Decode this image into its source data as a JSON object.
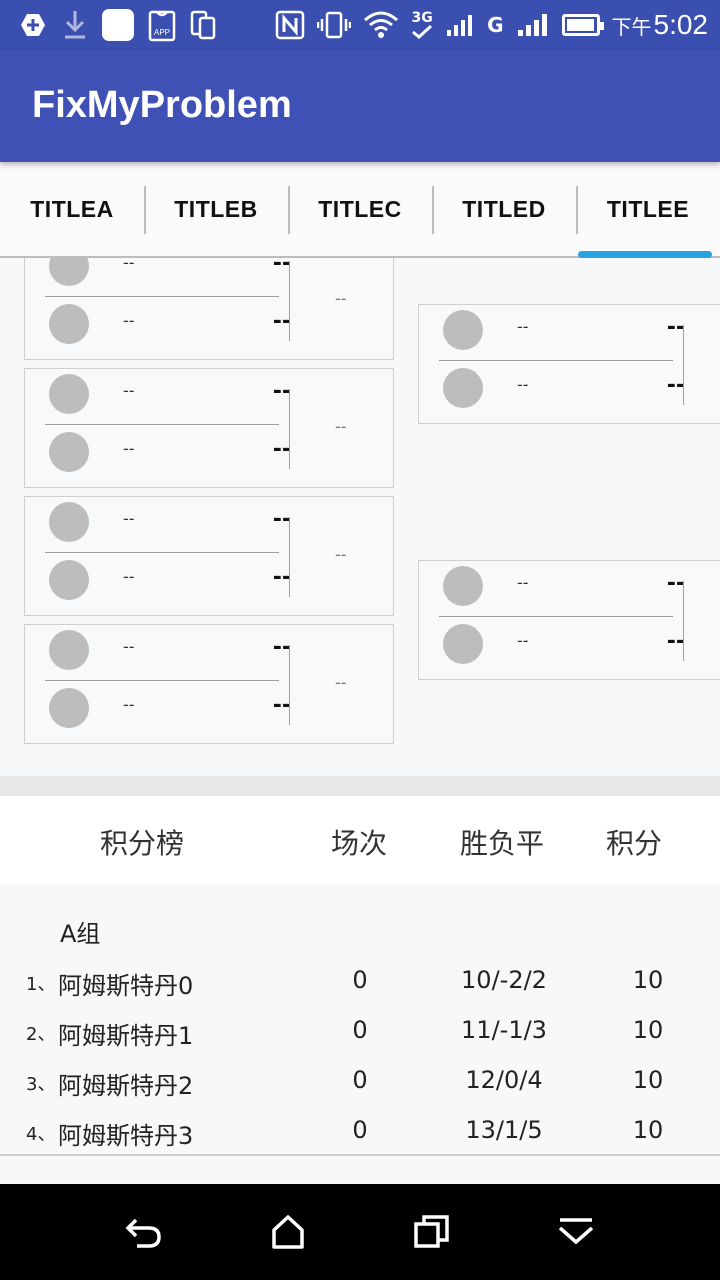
{
  "status_bar": {
    "time_prefix": "下午",
    "time": "5:02",
    "network_3g": "3G",
    "network_g": "G",
    "app_badge": "APP",
    "icons": [
      "add-icon",
      "download-icon",
      "app-icon",
      "app-store-icon",
      "copy-icon",
      "nfc-icon",
      "vibrate-icon",
      "wifi-icon",
      "signal-icon",
      "battery-icon"
    ]
  },
  "app_bar": {
    "title": "FixMyProblem"
  },
  "tabs": [
    {
      "label": "TITLEA"
    },
    {
      "label": "TITLEB"
    },
    {
      "label": "TITLEC"
    },
    {
      "label": "TITLED"
    },
    {
      "label": "TITLEE",
      "active": true
    }
  ],
  "bracket": {
    "left": [
      {
        "p1_name": "--",
        "p1_score": "--",
        "p2_name": "--",
        "p2_score": "--",
        "label": "--"
      },
      {
        "p1_name": "--",
        "p1_score": "--",
        "p2_name": "--",
        "p2_score": "--",
        "label": "--"
      },
      {
        "p1_name": "--",
        "p1_score": "--",
        "p2_name": "--",
        "p2_score": "--",
        "label": "--"
      },
      {
        "p1_name": "--",
        "p1_score": "--",
        "p2_name": "--",
        "p2_score": "--",
        "label": "--"
      }
    ],
    "right": [
      {
        "p1_name": "--",
        "p1_score": "--",
        "p2_name": "--",
        "p2_score": "--"
      },
      {
        "p1_name": "--",
        "p1_score": "--",
        "p2_name": "--",
        "p2_score": "--"
      }
    ]
  },
  "standings": {
    "headers": {
      "title": "积分榜",
      "matches": "场次",
      "wdl": "胜负平",
      "points": "积分"
    },
    "group": "A组",
    "rows": [
      {
        "idx": "1、",
        "team": "阿姆斯特丹0",
        "matches": "0",
        "wdl": "10/-2/2",
        "points": "10"
      },
      {
        "idx": "2、",
        "team": "阿姆斯特丹1",
        "matches": "0",
        "wdl": "11/-1/3",
        "points": "10"
      },
      {
        "idx": "3、",
        "team": "阿姆斯特丹2",
        "matches": "0",
        "wdl": "12/0/4",
        "points": "10"
      },
      {
        "idx": "4、",
        "team": "阿姆斯特丹3",
        "matches": "0",
        "wdl": "13/1/5",
        "points": "10"
      }
    ]
  },
  "colors": {
    "app_bar": "#3f51b5",
    "status_bar": "#3a4faf",
    "tab_indicator": "#29a3e0"
  }
}
